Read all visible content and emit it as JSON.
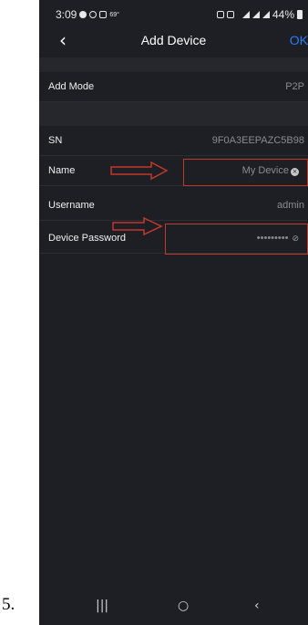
{
  "step_label": "5.",
  "status_bar": {
    "time": "3:09",
    "temp": "69°",
    "battery": "44%"
  },
  "nav": {
    "back_icon": "chevron-left-icon",
    "title": "Add Device",
    "ok_label": "OK"
  },
  "rows": [
    {
      "label": "Add Mode",
      "value": "P2P"
    },
    {
      "label": "SN",
      "value": "9F0A3EEPAZC5B98"
    },
    {
      "label": "Name",
      "value": "My Device"
    },
    {
      "label": "Username",
      "value": "admin"
    },
    {
      "label": "Device Password",
      "value": "•••••••••"
    }
  ],
  "nav_bar": {
    "recents_icon": "recents-icon",
    "home_icon": "home-circle-icon",
    "back_icon": "back-chevron-icon"
  },
  "colors": {
    "background": "#1e1f24",
    "accent": "#2e7cf6",
    "annotation": "#c0392b"
  }
}
